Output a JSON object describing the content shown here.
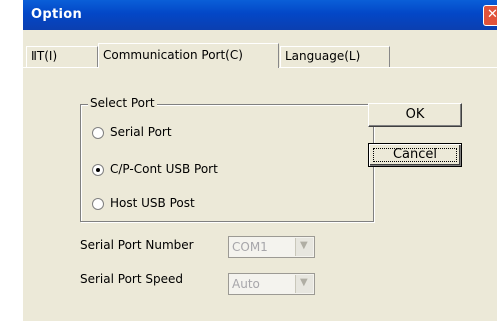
{
  "window": {
    "title": "Option",
    "close_glyph": "✕"
  },
  "tabs": [
    {
      "label": "ⅡT(I)"
    },
    {
      "label": "Communication Port(C)"
    },
    {
      "label": "Language(L)"
    }
  ],
  "select_port": {
    "caption": "Select Port",
    "options": [
      {
        "label": "Serial Port",
        "selected": false
      },
      {
        "label": "C/P-Cont USB Port",
        "selected": true
      },
      {
        "label": "Host USB Post",
        "selected": false
      }
    ]
  },
  "buttons": {
    "ok": "OK",
    "cancel": "Cancel"
  },
  "fields": {
    "port_number": {
      "label": "Serial Port Number",
      "value": "COM1",
      "arrow": "▼"
    },
    "port_speed": {
      "label": "Serial Port Speed",
      "value": "Auto",
      "arrow": "▼"
    }
  },
  "colors": {
    "titlebar": "#0347c7",
    "dialog_bg": "#ece9d8",
    "close_button": "#e1533a"
  }
}
